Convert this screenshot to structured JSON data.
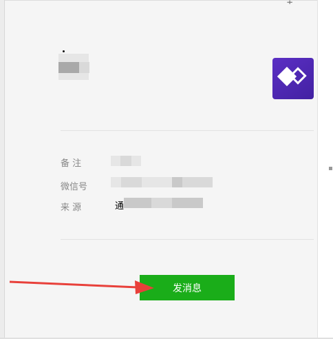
{
  "window": {
    "pin_glyph": "∓"
  },
  "profile": {
    "card_icon": "purple-diamond-app-icon"
  },
  "details": {
    "remark_label": "备  注",
    "wechat_id_label": "微信号",
    "source_label": "来  源",
    "source_value_visible": "通"
  },
  "actions": {
    "send_message_label": "发消息"
  },
  "annotation": {
    "arrow_color": "#e8403a"
  },
  "colors": {
    "send_button": "#1aad19",
    "app_icon": "#4e25b5"
  }
}
